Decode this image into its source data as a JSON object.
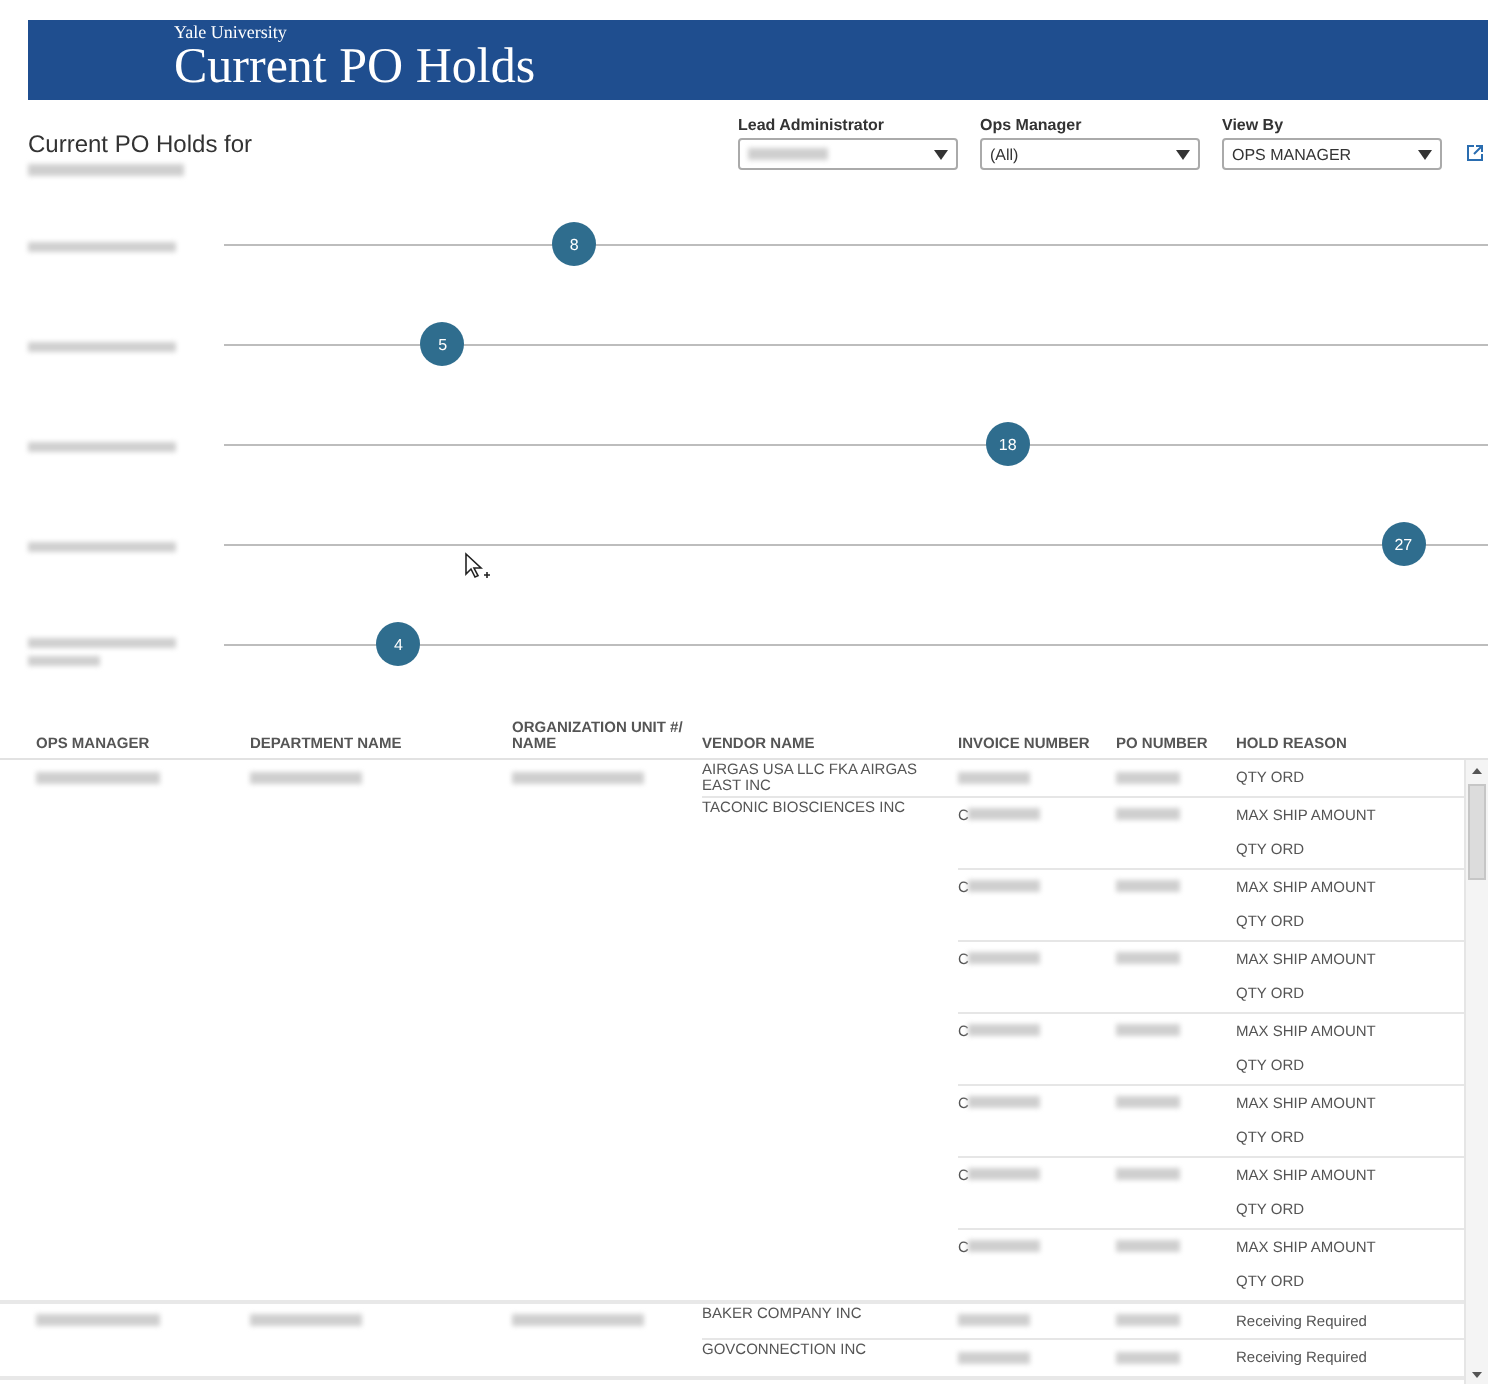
{
  "banner": {
    "kicker": "Yale University",
    "title": "Current PO Holds"
  },
  "subtitle": {
    "text": "Current PO Holds for",
    "scope": {
      "kind": "redacted"
    }
  },
  "filters": [
    {
      "label": "Lead Administrator",
      "value": {
        "kind": "redacted"
      }
    },
    {
      "label": "Ops Manager",
      "value": {
        "kind": "text",
        "text": "(All)"
      }
    },
    {
      "label": "View By",
      "value": {
        "kind": "text",
        "text": "OPS MANAGER"
      }
    }
  ],
  "dot_rows": [
    {
      "label": {
        "kind": "redacted"
      },
      "count": "8",
      "level": 0.277
    },
    {
      "label": {
        "kind": "redacted"
      },
      "count": "5",
      "level": 0.173
    },
    {
      "label": {
        "kind": "redacted"
      },
      "count": "18",
      "level": 0.62
    },
    {
      "label": {
        "kind": "redacted"
      },
      "count": "27",
      "level": 0.933
    },
    {
      "label": {
        "kind": "wrapped"
      },
      "count": "4",
      "level": 0.138
    }
  ],
  "table": {
    "columns": [
      "OPS MANAGER",
      "DEPARTMENT NAME",
      "ORGANIZATION UNIT #/ NAME",
      "VENDOR NAME",
      "INVOICE NUMBER",
      "PO NUMBER",
      "HOLD REASON"
    ],
    "rows": [
      {
        "ops_manager": {
          "kind": "redacted"
        },
        "department": {
          "kind": "redacted"
        },
        "org_unit": {
          "kind": "redacted"
        },
        "vendors": [
          {
            "name": "AIRGAS USA LLC FKA AIRGAS EAST INC",
            "invoices": [
              {
                "invoice": {
                  "kind": "redacted"
                },
                "po": {
                  "kind": "redacted"
                },
                "hold_reasons": [
                  "QTY ORD"
                ]
              }
            ]
          },
          {
            "name": "TACONIC BIOSCIENCES INC",
            "invoices": [
              {
                "invoice": {
                  "kind": "redacted",
                  "text": "C"
                },
                "po": {
                  "kind": "redacted"
                },
                "hold_reasons": [
                  "MAX SHIP AMOUNT",
                  "QTY ORD"
                ]
              },
              {
                "invoice": {
                  "kind": "redacted",
                  "text": "C"
                },
                "po": {
                  "kind": "redacted"
                },
                "hold_reasons": [
                  "MAX SHIP AMOUNT",
                  "QTY ORD"
                ]
              },
              {
                "invoice": {
                  "kind": "redacted",
                  "text": "C"
                },
                "po": {
                  "kind": "redacted"
                },
                "hold_reasons": [
                  "MAX SHIP AMOUNT",
                  "QTY ORD"
                ]
              },
              {
                "invoice": {
                  "kind": "redacted",
                  "text": "C"
                },
                "po": {
                  "kind": "redacted"
                },
                "hold_reasons": [
                  "MAX SHIP AMOUNT",
                  "QTY ORD"
                ]
              },
              {
                "invoice": {
                  "kind": "redacted",
                  "text": "C"
                },
                "po": {
                  "kind": "redacted"
                },
                "hold_reasons": [
                  "MAX SHIP AMOUNT",
                  "QTY ORD"
                ]
              },
              {
                "invoice": {
                  "kind": "redacted",
                  "text": "C"
                },
                "po": {
                  "kind": "redacted"
                },
                "hold_reasons": [
                  "MAX SHIP AMOUNT",
                  "QTY ORD"
                ]
              },
              {
                "invoice": {
                  "kind": "redacted",
                  "text": "C"
                },
                "po": {
                  "kind": "redacted"
                },
                "hold_reasons": [
                  "MAX SHIP AMOUNT",
                  "QTY ORD"
                ]
              }
            ]
          }
        ]
      },
      {
        "ops_manager": {
          "kind": "redacted"
        },
        "department": {
          "kind": "redacted"
        },
        "org_unit": {
          "kind": "redacted"
        },
        "vendors": [
          {
            "name": "BAKER COMPANY INC",
            "invoices": [
              {
                "invoice": {
                  "kind": "redacted"
                },
                "po": {
                  "kind": "redacted"
                },
                "hold_reasons": [
                  "Receiving Required"
                ]
              }
            ]
          },
          {
            "name": "GOVCONNECTION INC",
            "invoices": [
              {
                "invoice": {
                  "kind": "redacted"
                },
                "po": {
                  "kind": "redacted"
                },
                "hold_reasons": [
                  "Receiving Required"
                ]
              }
            ]
          }
        ]
      }
    ]
  }
}
